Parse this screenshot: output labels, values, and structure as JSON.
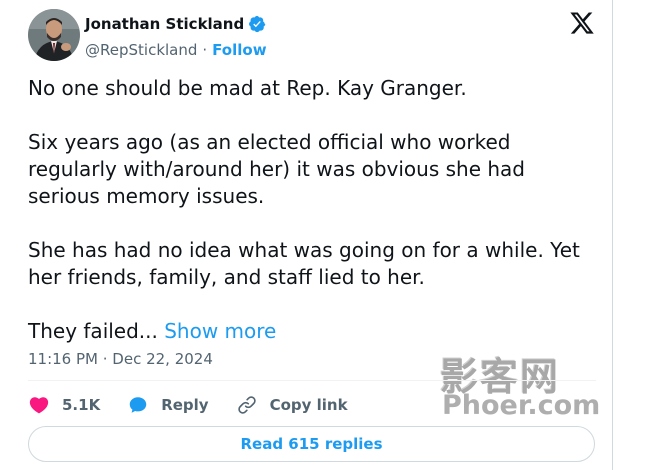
{
  "author": {
    "name": "Jonathan Stickland",
    "handle": "@RepStickland",
    "separator": "·",
    "follow_label": "Follow",
    "verified": true
  },
  "platform_icon": "x-logo-icon",
  "tweet": {
    "paragraphs": [
      "No one should be mad at Rep. Kay Granger.",
      "Six years ago (as an elected official who worked regularly with/around her) it was obvious she had serious memory issues.",
      "She has had no idea what was going on for a while. Yet her friends, family, and staff lied to her.",
      "They failed..."
    ],
    "show_more_label": "Show more",
    "timestamp": "11:16 PM · Dec 22, 2024"
  },
  "actions": {
    "like": {
      "icon": "heart-icon",
      "count": "5.1K"
    },
    "reply": {
      "icon": "speech-bubble-icon",
      "label": "Reply"
    },
    "copy_link": {
      "icon": "link-icon",
      "label": "Copy link"
    }
  },
  "read_replies_label": "Read 615 replies",
  "watermark": {
    "cn": "影客网",
    "en": "Phoer.com"
  },
  "colors": {
    "accent": "#1d9bf0",
    "like": "#f91880",
    "text_primary": "#0f1419",
    "text_secondary": "#536471"
  }
}
